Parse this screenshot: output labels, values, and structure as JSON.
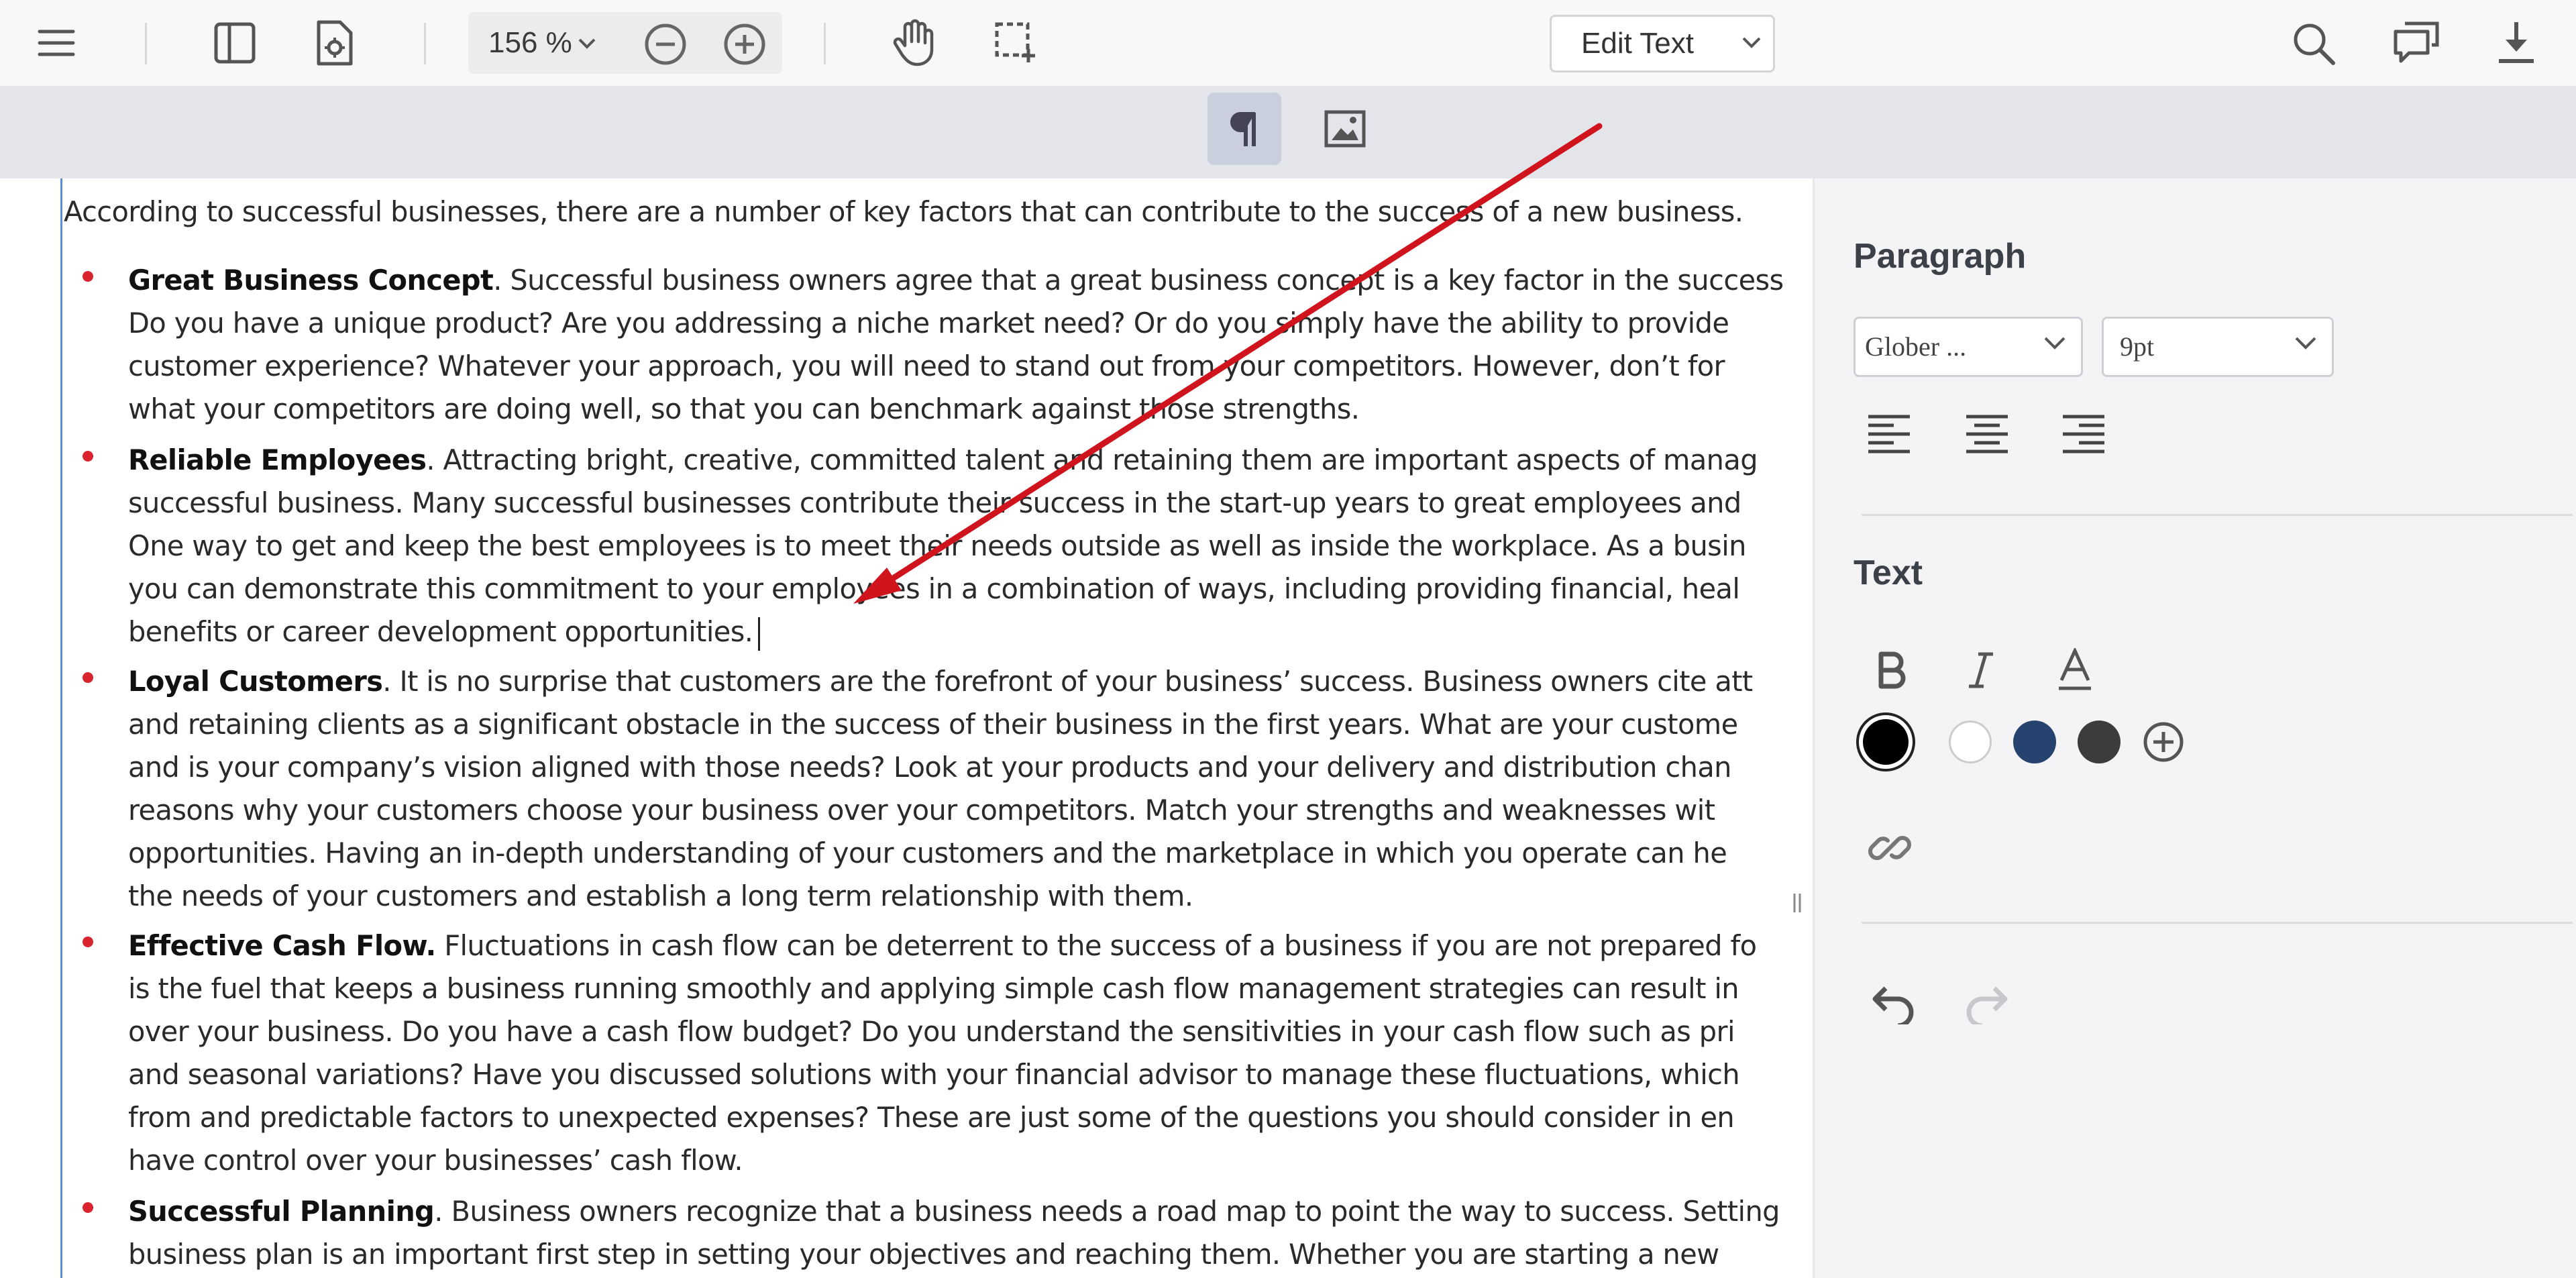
{
  "toolbar": {
    "zoom": "156 %",
    "edit_mode": "Edit Text"
  },
  "document": {
    "intro": "According to successful businesses, there are a number of key factors that can contribute to the success of a new business.",
    "paragraphs": [
      {
        "title": "Great Business Concept",
        "lines": [
          ". Successful business owners agree that a great business concept is a key factor in the success",
          "Do you have a unique product? Are you addressing a niche market need? Or do you simply have the ability to provide",
          "customer experience? Whatever your approach, you will need to stand out from your competitors. However, don’t for",
          "what your competitors are doing well, so that you can benchmark against those strengths."
        ]
      },
      {
        "title": "Reliable Employees",
        "lines": [
          ". Attracting bright, creative, committed talent and retaining them are important aspects of manag",
          "successful business. Many successful businesses contribute their success in the start-up years to great employees and",
          "One way to get and keep the best employees is to meet their needs outside as well as inside the workplace. As a busin",
          "you can demonstrate this commitment to your employees in a combination of ways, including providing financial, heal",
          "benefits or career development opportunities."
        ]
      },
      {
        "title": "Loyal Customers",
        "lines": [
          ". It is no surprise that customers are the forefront of your business’ success. Business owners cite att",
          "and retaining clients as a significant obstacle in the success of their business in the first years. What are your custome",
          "and is your company’s vision aligned with those needs? Look at your products and your delivery and distribution chan",
          "reasons why your customers choose your business over your competitors. Match your strengths and weaknesses wit",
          "opportunities. Having an in-depth understanding of your customers and the marketplace in which you operate can he",
          "the needs of your customers and establish a long term relationship with them."
        ]
      },
      {
        "title": "Effective Cash Flow.",
        "lines": [
          " Fluctuations in cash flow can be deterrent to the success of a business if you are not prepared fo",
          "is the fuel that keeps a business running smoothly and applying simple cash flow management strategies can result in",
          "over your business. Do you have a cash flow budget? Do you understand the sensitivities in your cash flow such as pri",
          "and seasonal variations? Have you discussed solutions with your financial advisor to manage these fluctuations, which",
          "from and predictable factors to unexpected expenses? These are just some of the questions you should consider in en",
          "have control over your businesses’ cash flow."
        ]
      },
      {
        "title": "Successful Planning",
        "lines": [
          ". Business owners recognize that a business needs a road map to point the way to success. Setting",
          "business plan is an important first step in setting your objectives and reaching them. Whether you are starting a new"
        ]
      }
    ]
  },
  "panel": {
    "paragraph_heading": "Paragraph",
    "font_family": "Glober ...",
    "font_size": "9pt",
    "text_heading": "Text",
    "colors": [
      "#000000",
      "#ffffff",
      "#26436f",
      "#3c3c3c"
    ]
  }
}
